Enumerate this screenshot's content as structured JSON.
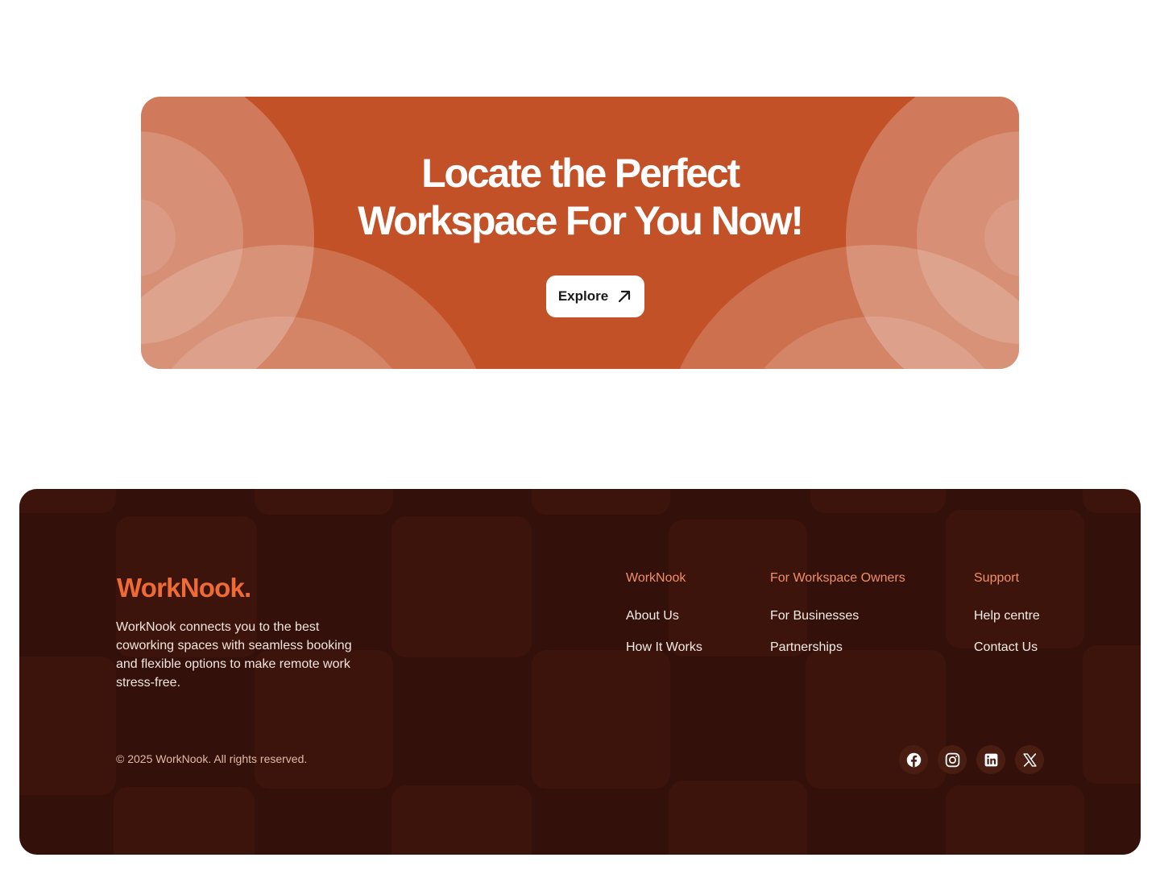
{
  "cta": {
    "title_line1": "Locate the Perfect",
    "title_line2": "Workspace For You Now!",
    "button_label": "Explore",
    "button_icon": "arrow-up-right-icon"
  },
  "footer": {
    "brand": "WorkNook.",
    "description": "WorkNook connects you to the best coworking spaces with seamless booking and flexible options to make remote work stress-free.",
    "columns": [
      {
        "heading": "WorkNook",
        "links": [
          "About Us",
          "How It Works"
        ]
      },
      {
        "heading": "For Workspace Owners",
        "links": [
          "For Businesses",
          "Partnerships"
        ]
      },
      {
        "heading": "Support",
        "links": [
          "Help centre",
          "Contact Us"
        ]
      }
    ],
    "copyright": "© 2025 WorkNook. All rights reserved.",
    "socials": [
      "facebook-icon",
      "instagram-icon",
      "linkedin-icon",
      "x-icon"
    ]
  },
  "colors": {
    "cta_background": "#c25128",
    "footer_background": "#33100a",
    "brand_accent": "#ee6b35",
    "footer_heading": "#f0906a"
  }
}
